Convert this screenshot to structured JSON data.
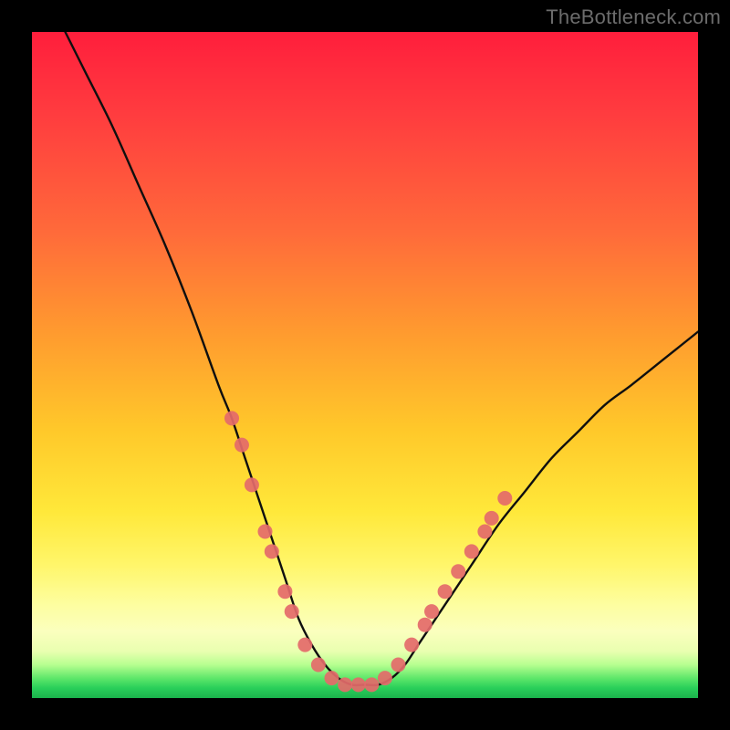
{
  "watermark": {
    "text": "TheBottleneck.com"
  },
  "colors": {
    "background_frame": "#000000",
    "curve_stroke": "#0f0f0f",
    "marker_fill": "#e46a6a",
    "marker_stroke": "#b84e50",
    "gradient_top": "#ff1e3c",
    "gradient_mid": "#ffe83a",
    "gradient_bottom": "#1bb24c"
  },
  "chart_data": {
    "type": "line",
    "title": "",
    "xlabel": "",
    "ylabel": "",
    "xlim": [
      0,
      100
    ],
    "ylim": [
      0,
      100
    ],
    "legend": false,
    "grid": false,
    "series": [
      {
        "name": "curve",
        "x": [
          5,
          8,
          12,
          16,
          20,
          24,
          28,
          30,
          32,
          34,
          36,
          38,
          40,
          42,
          44,
          46,
          48,
          50,
          52,
          54,
          56,
          58,
          62,
          66,
          70,
          74,
          78,
          82,
          86,
          90,
          95,
          100
        ],
        "y": [
          100,
          94,
          86,
          77,
          68,
          58,
          47,
          42,
          36,
          30,
          24,
          18,
          12,
          8,
          5,
          3,
          2,
          2,
          2,
          3,
          5,
          8,
          14,
          20,
          26,
          31,
          36,
          40,
          44,
          47,
          51,
          55
        ]
      }
    ],
    "markers": [
      {
        "x": 30,
        "y": 42
      },
      {
        "x": 31.5,
        "y": 38
      },
      {
        "x": 33,
        "y": 32
      },
      {
        "x": 35,
        "y": 25
      },
      {
        "x": 36,
        "y": 22
      },
      {
        "x": 38,
        "y": 16
      },
      {
        "x": 39,
        "y": 13
      },
      {
        "x": 41,
        "y": 8
      },
      {
        "x": 43,
        "y": 5
      },
      {
        "x": 45,
        "y": 3
      },
      {
        "x": 47,
        "y": 2
      },
      {
        "x": 49,
        "y": 2
      },
      {
        "x": 51,
        "y": 2
      },
      {
        "x": 53,
        "y": 3
      },
      {
        "x": 55,
        "y": 5
      },
      {
        "x": 57,
        "y": 8
      },
      {
        "x": 59,
        "y": 11
      },
      {
        "x": 60,
        "y": 13
      },
      {
        "x": 62,
        "y": 16
      },
      {
        "x": 64,
        "y": 19
      },
      {
        "x": 66,
        "y": 22
      },
      {
        "x": 68,
        "y": 25
      },
      {
        "x": 69,
        "y": 27
      },
      {
        "x": 71,
        "y": 30
      }
    ],
    "annotations": []
  }
}
